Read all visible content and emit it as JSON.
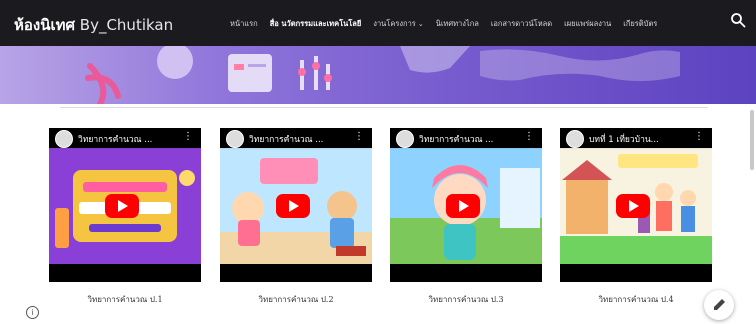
{
  "site": {
    "title_main": "ห้องนิเทศ",
    "title_suffix": " By_Chutikan"
  },
  "nav": {
    "items": [
      {
        "label": "หน้าแรก"
      },
      {
        "label": "สื่อ นวัตกรรมและเทคโนโลยี",
        "active": true
      },
      {
        "label": "งานโครงการ",
        "dropdown": true
      },
      {
        "label": "นิเทศทางไกล"
      },
      {
        "label": "เอกสารดาวน์โหลด"
      },
      {
        "label": "เผยแพร่ผลงาน"
      },
      {
        "label": "เกียรติบัตร"
      }
    ],
    "search_icon": "search-icon"
  },
  "videos": [
    {
      "header_title": "วิทยาการคำนวณ ...",
      "caption": "วิทยาการคำนวณ ป.1",
      "thumb_colors": [
        "#8a3fd6",
        "#f5c542"
      ]
    },
    {
      "header_title": "วิทยาการคำนวณ ...",
      "caption": "วิทยาการคำนวณ ป.2",
      "thumb_colors": [
        "#ff8fb6",
        "#bfe6ff"
      ]
    },
    {
      "header_title": "วิทยาการคำนวณ ...",
      "caption": "วิทยาการคำนวณ ป.3",
      "thumb_colors": [
        "#8ed3ff",
        "#ffffff"
      ]
    },
    {
      "header_title": "บทที่ 1 เที่ยวบ้าน...",
      "caption": "วิทยาการคำนวณ ป.4",
      "thumb_colors": [
        "#6fd35f",
        "#ffe680"
      ]
    }
  ],
  "colors": {
    "topbar": "#1b1b1f",
    "play": "#ff0000",
    "banner_start": "#b8a4e6",
    "banner_end": "#5c43bf"
  }
}
